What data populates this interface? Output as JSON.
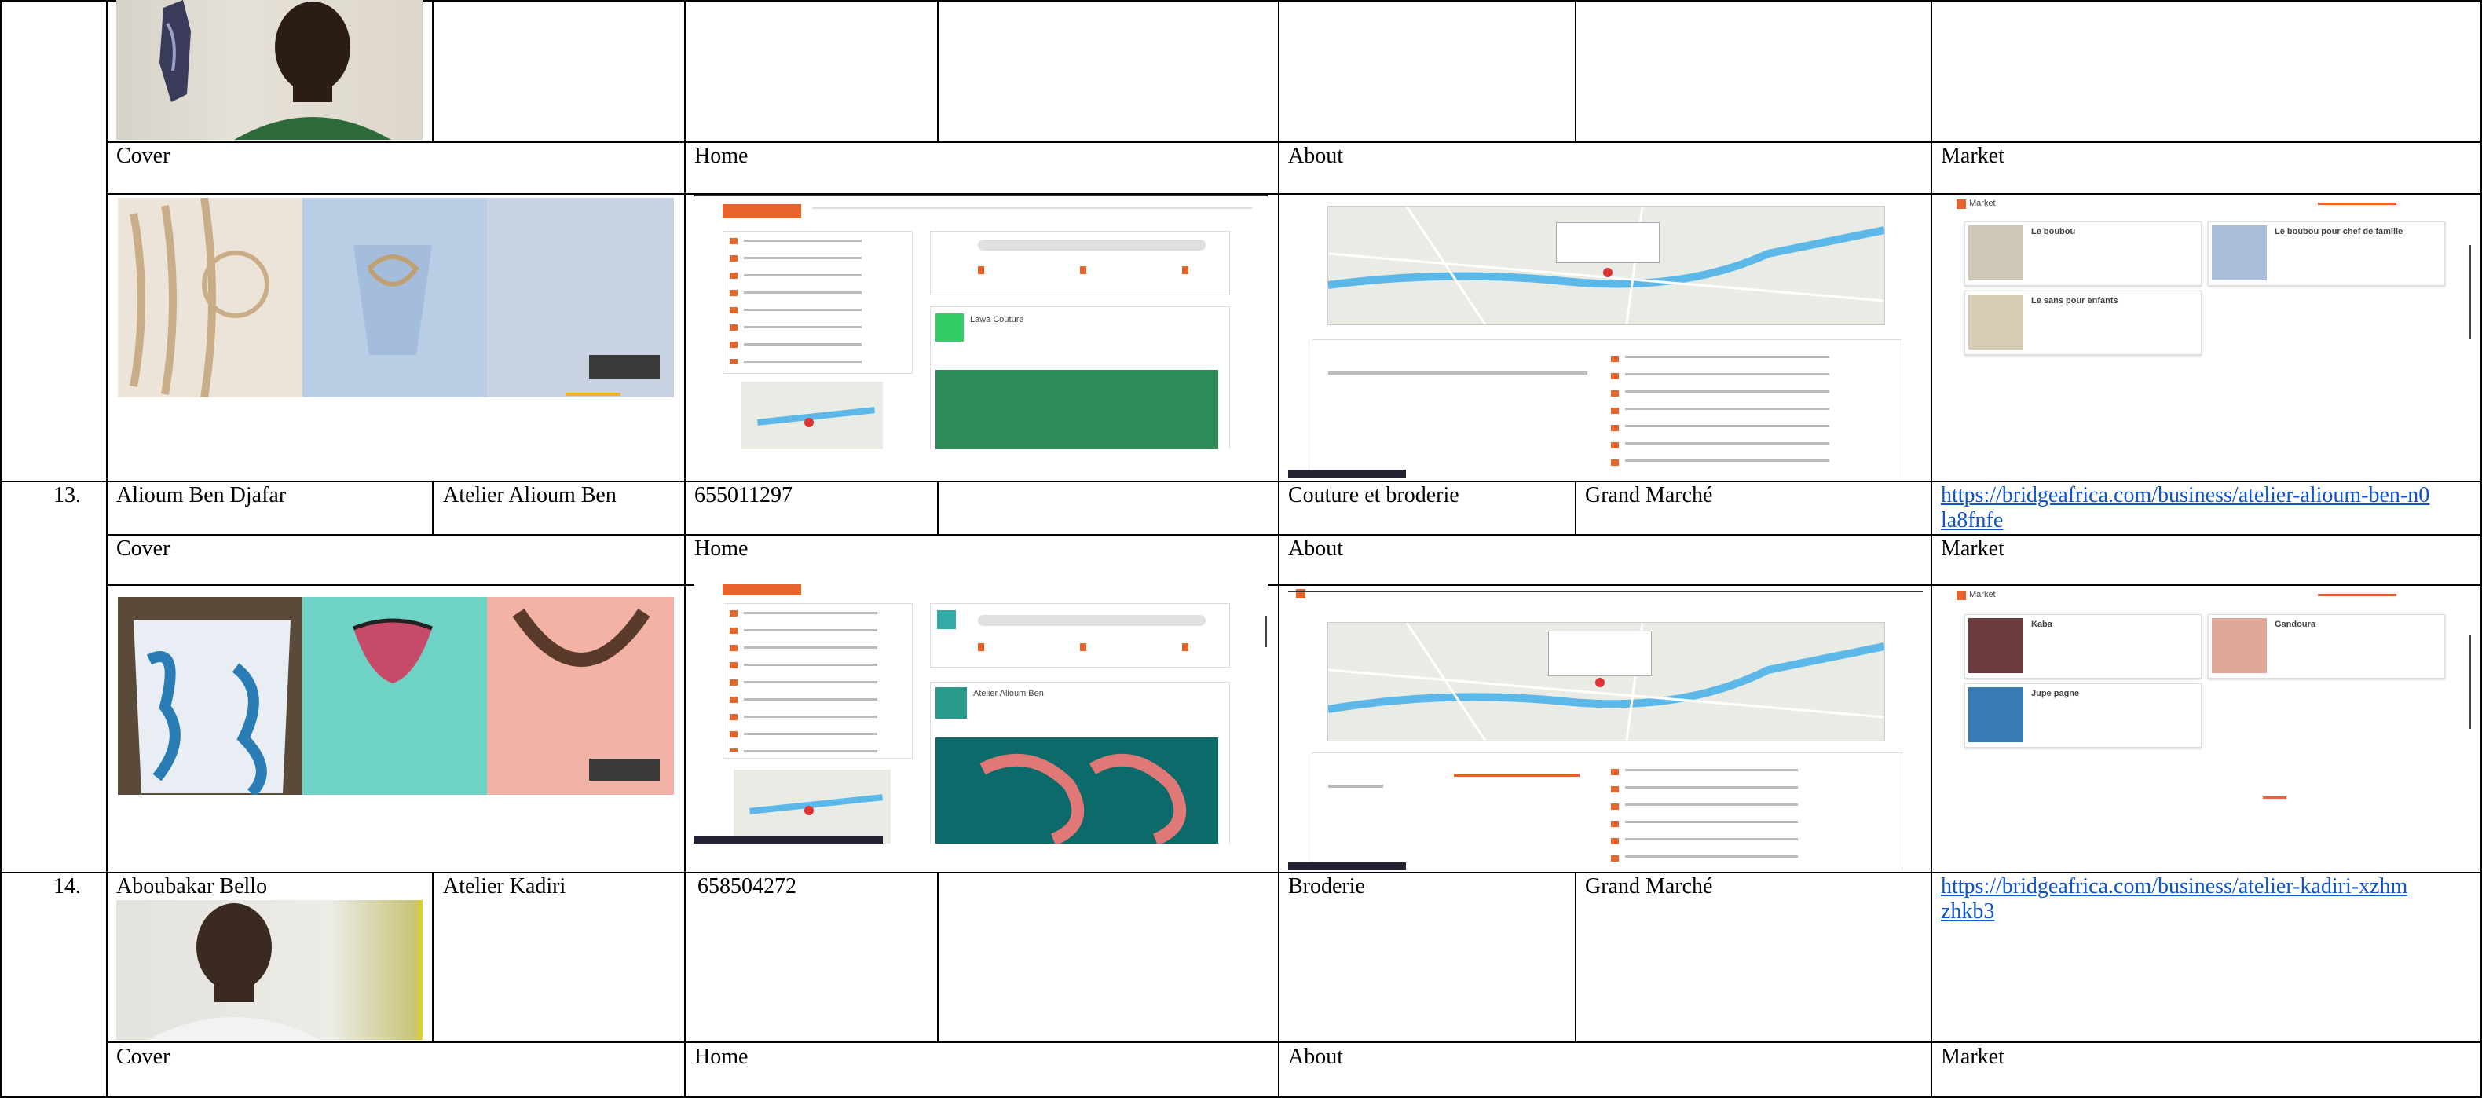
{
  "section_labels": {
    "cover": "Cover",
    "home": "Home",
    "about": "About",
    "market": "Market"
  },
  "rows": [
    {
      "number": "13.",
      "name": "Alioum Ben Djafar",
      "business": "Atelier Alioum Ben",
      "phone": "655011297",
      "activity": "Couture et broderie",
      "location": "Grand Marché",
      "url": "https://bridgeafrica.com/business/atelier-alioum-ben-n0la8fnfe",
      "home_card_title": "Atelier Alioum Ben"
    },
    {
      "number": "14.",
      "name": "Aboubakar Bello",
      "business": "Atelier Kadiri",
      "phone": "658504272",
      "activity": "Broderie",
      "location": "Grand Marché",
      "url": "https://bridgeafrica.com/business/atelier-kadiri-xzhmzhkb3"
    }
  ],
  "previous_row": {
    "home_card_title": "Lawa Couture"
  },
  "market_previous": {
    "heading": "Market",
    "items": [
      "Le boubou",
      "Le boubou pour chef de famille",
      "Le sans pour enfants"
    ]
  },
  "market_row13": {
    "heading": "Market",
    "items": [
      "Kaba",
      "Gandoura",
      "Jupe pagne"
    ]
  },
  "colors": {
    "accent": "#e8622c",
    "link": "#1155cc",
    "map_water": "#5bb8e8",
    "map_land": "#e9ece4"
  }
}
